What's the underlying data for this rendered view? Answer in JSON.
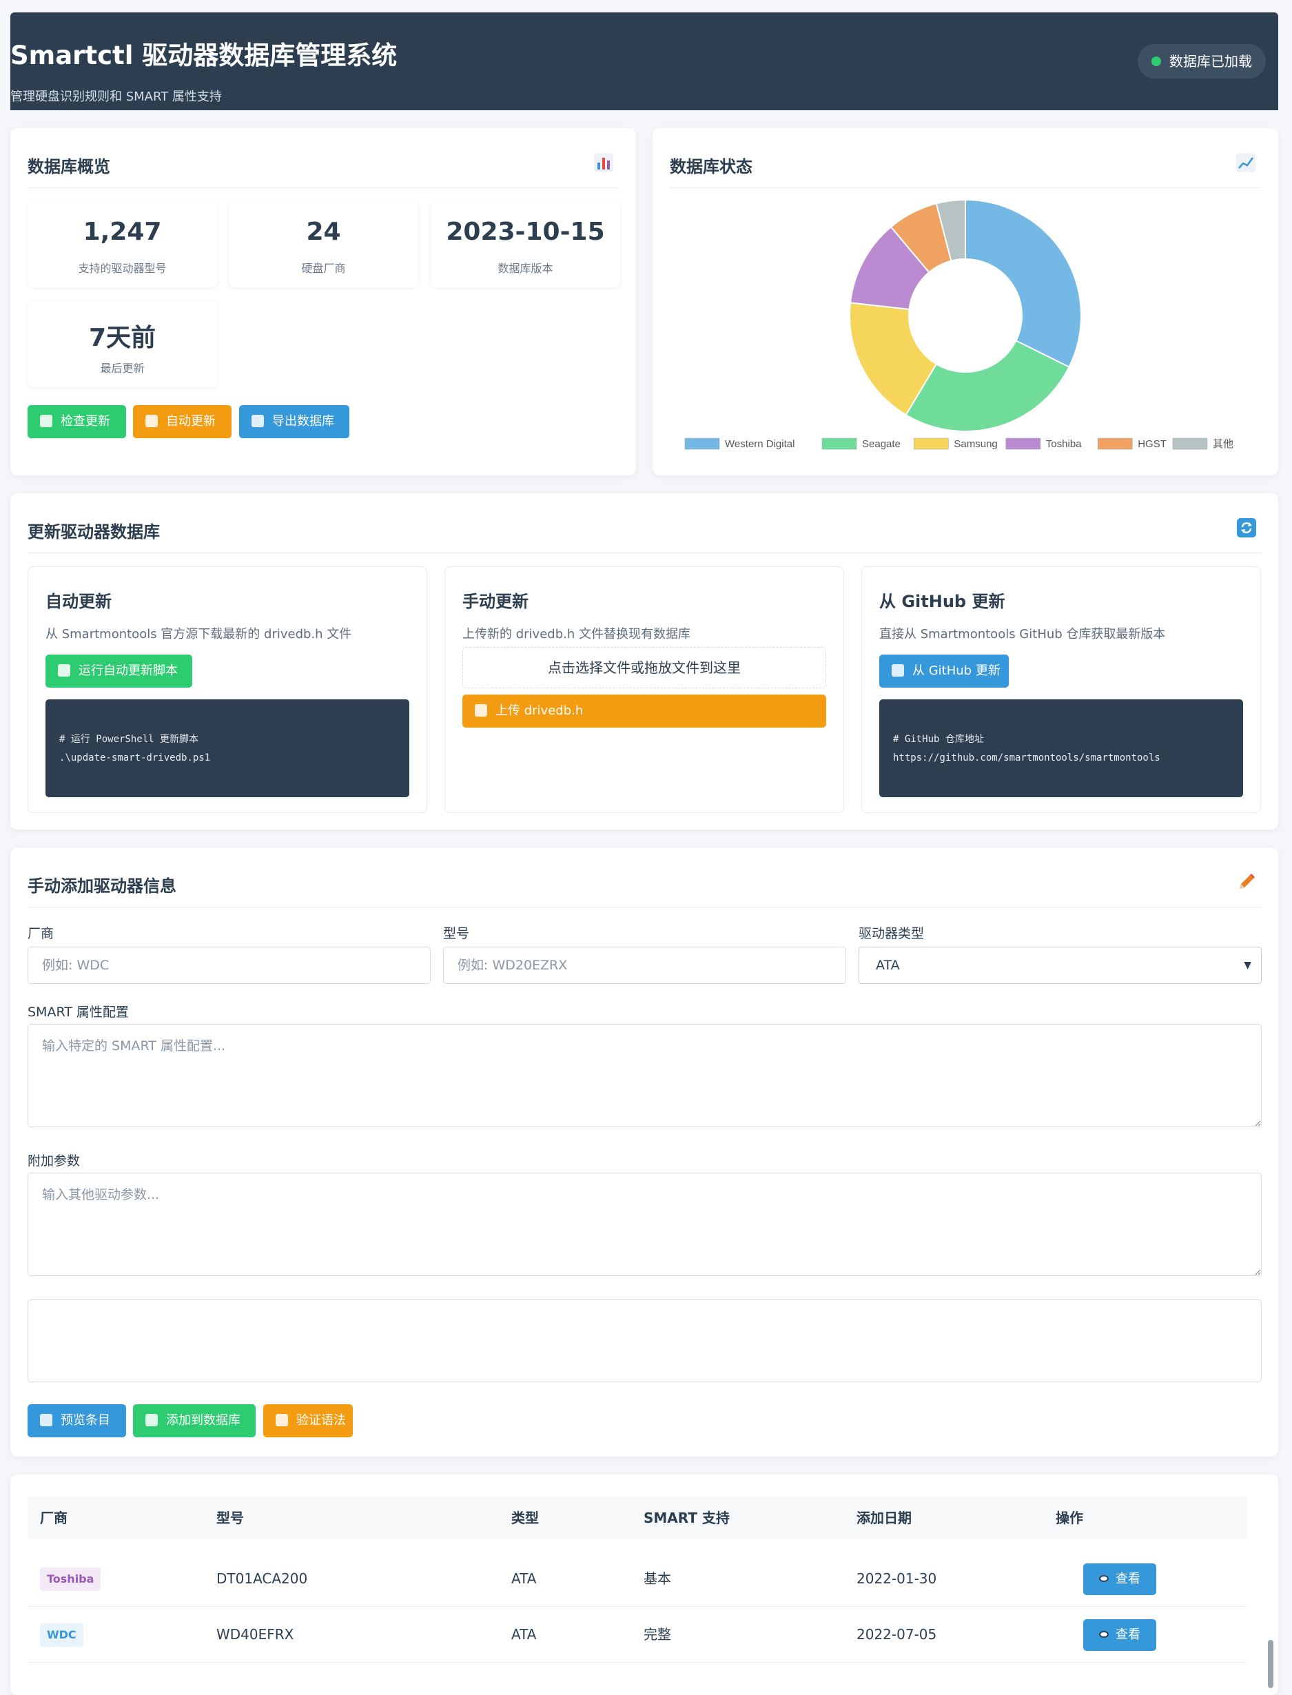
{
  "header": {
    "title": "Smartctl 驱动器数据库管理系统",
    "subtitle": "管理硬盘识别规则和 SMART 属性支持",
    "status": "数据库已加载"
  },
  "overview": {
    "title": "数据库概览",
    "icon": "bar-chart-icon",
    "stats": [
      {
        "value": "1,247",
        "label": "支持的驱动器型号"
      },
      {
        "value": "24",
        "label": "硬盘厂商"
      },
      {
        "value": "2023-10-15",
        "label": "数据库版本"
      },
      {
        "value": "7天前",
        "label": "最后更新"
      }
    ],
    "buttons": {
      "check": "检查更新",
      "auto": "自动更新",
      "export": "导出数据库"
    }
  },
  "status_card": {
    "title": "数据库状态",
    "icon": "trend-chart-icon"
  },
  "chart_data": {
    "type": "pie",
    "categories": [
      "Western Digital",
      "Seagate",
      "Samsung",
      "Toshiba",
      "HGST",
      "其他"
    ],
    "values": [
      32,
      26,
      18,
      12,
      7,
      4
    ],
    "colors": [
      "#74b9e6",
      "#6fdc9a",
      "#f5d55a",
      "#bb8bd1",
      "#f0a262",
      "#b6c2c4"
    ],
    "donut": true,
    "legend": "bottom"
  },
  "update": {
    "title": "更新驱动器数据库",
    "icon": "refresh-icon",
    "auto": {
      "title": "自动更新",
      "desc": "从 Smartmontools 官方源下载最新的 drivedb.h 文件",
      "button": "运行自动更新脚本",
      "code": [
        "# 运行 PowerShell 更新脚本",
        ".\\update-smart-drivedb.ps1"
      ]
    },
    "manual": {
      "title": "手动更新",
      "desc": "上传新的 drivedb.h 文件替换现有数据库",
      "dropzone": "点击选择文件或拖放文件到这里",
      "button": "上传 drivedb.h"
    },
    "github": {
      "title": "从 GitHub 更新",
      "desc": "直接从 Smartmontools GitHub 仓库获取最新版本",
      "button": "从 GitHub 更新",
      "code": [
        "# GitHub 仓库地址",
        "https://github.com/smartmontools/smartmontools"
      ]
    }
  },
  "add_form": {
    "title": "手动添加驱动器信息",
    "icon": "pencil-icon",
    "vendor_label": "厂商",
    "vendor_placeholder": "例如: WDC",
    "model_label": "型号",
    "model_placeholder": "例如: WD20EZRX",
    "type_label": "驱动器类型",
    "type_value": "ATA",
    "smart_label": "SMART 属性配置",
    "smart_placeholder": "输入特定的 SMART 属性配置...",
    "extra_label": "附加参数",
    "extra_placeholder": "输入其他驱动参数...",
    "buttons": {
      "preview": "预览条目",
      "add": "添加到数据库",
      "validate": "验证语法"
    }
  },
  "table": {
    "headers": [
      "厂商",
      "型号",
      "类型",
      "SMART 支持",
      "添加日期",
      "操作"
    ],
    "rows": [
      {
        "vendor": "Toshiba",
        "model": "DT01ACA200",
        "type": "ATA",
        "smart": "基本",
        "date": "2022-01-30",
        "action": "查看"
      },
      {
        "vendor": "WDC",
        "model": "WD40EFRX",
        "type": "ATA",
        "smart": "完整",
        "date": "2022-07-05",
        "action": "查看"
      }
    ]
  }
}
